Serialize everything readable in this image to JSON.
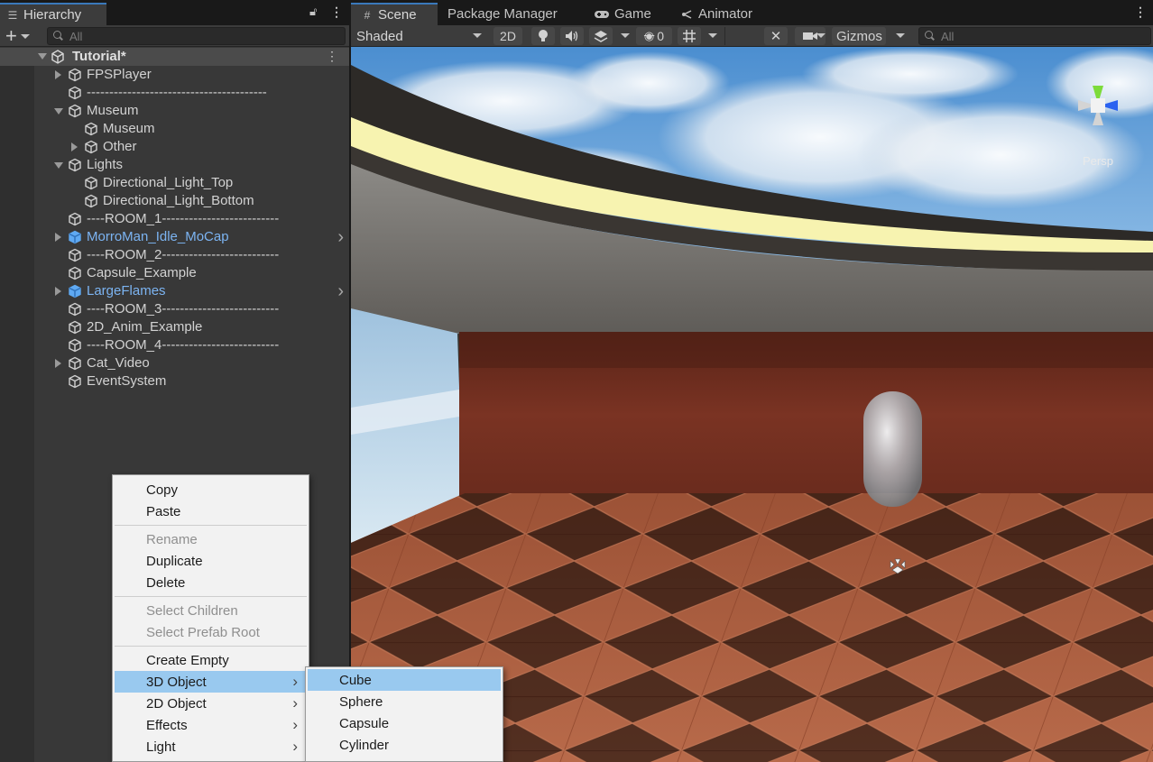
{
  "hierarchy": {
    "tab_label": "Hierarchy",
    "add_label": "+",
    "search_placeholder": "All",
    "scene_name": "Tutorial*",
    "items": [
      {
        "label": "FPSPlayer",
        "depth": 0,
        "expander": "collapsed",
        "prefab": false
      },
      {
        "label": "----------------------------------------",
        "depth": 0,
        "expander": "none",
        "prefab": false
      },
      {
        "label": "Museum",
        "depth": 0,
        "expander": "expanded",
        "prefab": false
      },
      {
        "label": "Museum",
        "depth": 1,
        "expander": "none",
        "prefab": false
      },
      {
        "label": "Other",
        "depth": 1,
        "expander": "collapsed",
        "prefab": false
      },
      {
        "label": "Lights",
        "depth": 0,
        "expander": "expanded",
        "prefab": false
      },
      {
        "label": "Directional_Light_Top",
        "depth": 1,
        "expander": "none",
        "prefab": false
      },
      {
        "label": "Directional_Light_Bottom",
        "depth": 1,
        "expander": "none",
        "prefab": false
      },
      {
        "label": "----ROOM_1--------------------------",
        "depth": 0,
        "expander": "none",
        "prefab": false
      },
      {
        "label": "MorroMan_Idle_MoCap",
        "depth": 0,
        "expander": "collapsed",
        "prefab": true
      },
      {
        "label": "----ROOM_2--------------------------",
        "depth": 0,
        "expander": "none",
        "prefab": false
      },
      {
        "label": "Capsule_Example",
        "depth": 0,
        "expander": "none",
        "prefab": false
      },
      {
        "label": "LargeFlames",
        "depth": 0,
        "expander": "collapsed",
        "prefab": true
      },
      {
        "label": "----ROOM_3--------------------------",
        "depth": 0,
        "expander": "none",
        "prefab": false
      },
      {
        "label": "2D_Anim_Example",
        "depth": 0,
        "expander": "none",
        "prefab": false
      },
      {
        "label": "----ROOM_4--------------------------",
        "depth": 0,
        "expander": "none",
        "prefab": false
      },
      {
        "label": "Cat_Video",
        "depth": 0,
        "expander": "collapsed",
        "prefab": false
      },
      {
        "label": "EventSystem",
        "depth": 0,
        "expander": "none",
        "prefab": false
      }
    ]
  },
  "scene": {
    "tabs": [
      {
        "label": "Scene",
        "icon": "hash-icon",
        "active": true
      },
      {
        "label": "Package Manager",
        "icon": "",
        "active": false
      },
      {
        "label": "Game",
        "icon": "gamepad-icon",
        "active": false
      },
      {
        "label": "Animator",
        "icon": "animator-icon",
        "active": false
      }
    ],
    "toolbar": {
      "shading_mode": "Shaded",
      "mode_2d": "2D",
      "hidden_count": "0",
      "gizmos": "Gizmos",
      "search_placeholder": "All"
    },
    "persp_label": "Persp"
  },
  "context_menu": {
    "items": [
      {
        "label": "Copy",
        "enabled": true
      },
      {
        "label": "Paste",
        "enabled": true
      },
      {
        "separator": true
      },
      {
        "label": "Rename",
        "enabled": false
      },
      {
        "label": "Duplicate",
        "enabled": true
      },
      {
        "label": "Delete",
        "enabled": true
      },
      {
        "separator": true
      },
      {
        "label": "Select Children",
        "enabled": false
      },
      {
        "label": "Select Prefab Root",
        "enabled": false
      },
      {
        "separator": true
      },
      {
        "label": "Create Empty",
        "enabled": true
      },
      {
        "label": "3D Object",
        "enabled": true,
        "submenu": true,
        "highlighted": true
      },
      {
        "label": "2D Object",
        "enabled": true,
        "submenu": true
      },
      {
        "label": "Effects",
        "enabled": true,
        "submenu": true
      },
      {
        "label": "Light",
        "enabled": true,
        "submenu": true
      }
    ],
    "submenu_items": [
      {
        "label": "Cube",
        "highlighted": true
      },
      {
        "label": "Sphere"
      },
      {
        "label": "Capsule"
      },
      {
        "label": "Cylinder"
      }
    ]
  },
  "colors": {
    "prefab_blue": "#7cb4f2",
    "menu_highlight": "#99c9ef",
    "tab_accent": "#3a79bb",
    "gizmo_y": "#7ddb3a",
    "gizmo_x": "#2b62f0"
  }
}
